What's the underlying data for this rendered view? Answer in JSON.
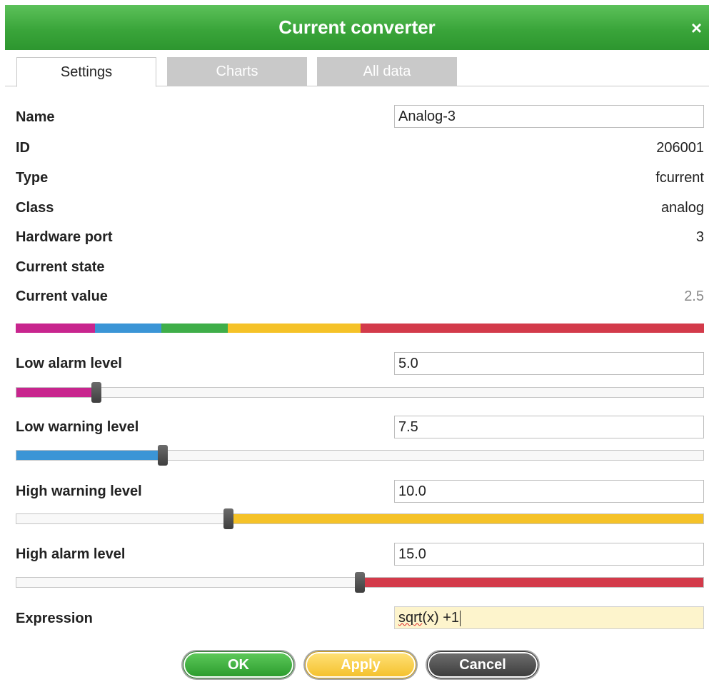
{
  "window": {
    "title": "Current converter",
    "close_glyph": "×"
  },
  "tabs": [
    {
      "label": "Settings",
      "active": true
    },
    {
      "label": "Charts",
      "active": false
    },
    {
      "label": "All data",
      "active": false
    }
  ],
  "fields": {
    "name": {
      "label": "Name",
      "value": "Analog-3"
    },
    "id": {
      "label": "ID",
      "value": "206001"
    },
    "type": {
      "label": "Type",
      "value": "fcurrent"
    },
    "class": {
      "label": "Class",
      "value": "analog"
    },
    "hardware_port": {
      "label": "Hardware port",
      "value": "3"
    },
    "current_state": {
      "label": "Current state",
      "value": ""
    },
    "current_value": {
      "label": "Current value",
      "value": "2.5"
    }
  },
  "levels": {
    "low_alarm": {
      "label": "Low alarm level",
      "value": "5.0",
      "color": "#c8258e"
    },
    "low_warning": {
      "label": "Low warning level",
      "value": "7.5",
      "color": "#3b95d6"
    },
    "high_warning": {
      "label": "High warning level",
      "value": "10.0",
      "color": "#f5c228"
    },
    "high_alarm": {
      "label": "High alarm level",
      "value": "15.0",
      "color": "#d33a4a"
    }
  },
  "colorbar_segments": [
    {
      "color": "#c8258e",
      "fraction": 0.115
    },
    {
      "color": "#3b95d6",
      "fraction": 0.097
    },
    {
      "color": "#3fae49",
      "fraction": 0.096
    },
    {
      "color": "#f5c228",
      "fraction": 0.193
    },
    {
      "color": "#d33a4a",
      "fraction": 0.499
    }
  ],
  "expression": {
    "label": "Expression",
    "value_word": "sqrt",
    "value_rest": "(x) +1"
  },
  "buttons": {
    "ok": "OK",
    "apply": "Apply",
    "cancel": "Cancel"
  }
}
